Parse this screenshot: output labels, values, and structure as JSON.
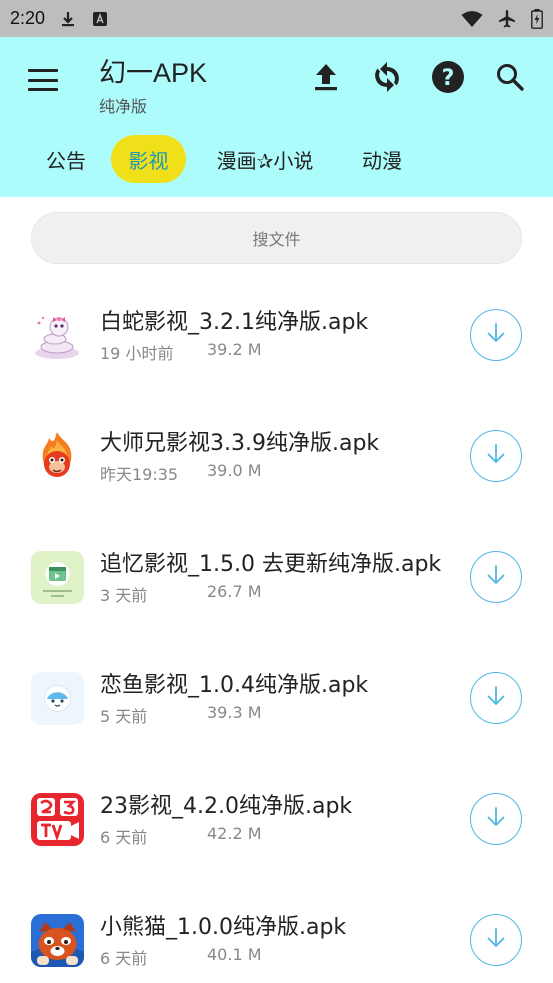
{
  "status_bar": {
    "time": "2:20",
    "left_icons": [
      "download-icon",
      "a-notification-icon"
    ],
    "right_icons": [
      "wifi-icon",
      "airplane-icon",
      "battery-icon"
    ]
  },
  "app_bar": {
    "background": "#adfcfc",
    "title": "幻一APK",
    "subtitle": "纯净版",
    "actions": [
      "upload-icon",
      "refresh-icon",
      "help-icon",
      "search-icon"
    ]
  },
  "tabs": [
    {
      "label": "公告",
      "active": false
    },
    {
      "label": "影视",
      "active": true
    },
    {
      "label": "漫画✰小说",
      "active": false
    },
    {
      "label": "动漫",
      "active": false
    }
  ],
  "search": {
    "placeholder": "搜文件"
  },
  "files": [
    {
      "name": "白蛇影视_3.2.1纯净版.apk",
      "time": "19 小时前",
      "size": "39.2 M",
      "icon": "white-snake-app-icon"
    },
    {
      "name": "大师兄影视3.3.9纯净版.apk",
      "time": "昨天19:35",
      "size": "39.0 M",
      "icon": "fire-monkey-app-icon"
    },
    {
      "name": "追忆影视_1.5.0 去更新纯净版.apk",
      "time": "3 天前",
      "size": "26.7 M",
      "icon": "zhuiyi-app-icon"
    },
    {
      "name": "恋鱼影视_1.0.4纯净版.apk",
      "time": "5 天前",
      "size": "39.3 M",
      "icon": "lianyu-app-icon"
    },
    {
      "name": "23影视_4.2.0纯净版.apk",
      "time": "6 天前",
      "size": "42.2 M",
      "icon": "23tv-app-icon"
    },
    {
      "name": "小熊猫_1.0.0纯净版.apk",
      "time": "6 天前",
      "size": "40.1 M",
      "icon": "red-panda-app-icon"
    }
  ],
  "colors": {
    "accent": "#4fb6e6",
    "tab_active_bg": "#f0e01a",
    "tab_active_text": "#1a9ab5"
  }
}
